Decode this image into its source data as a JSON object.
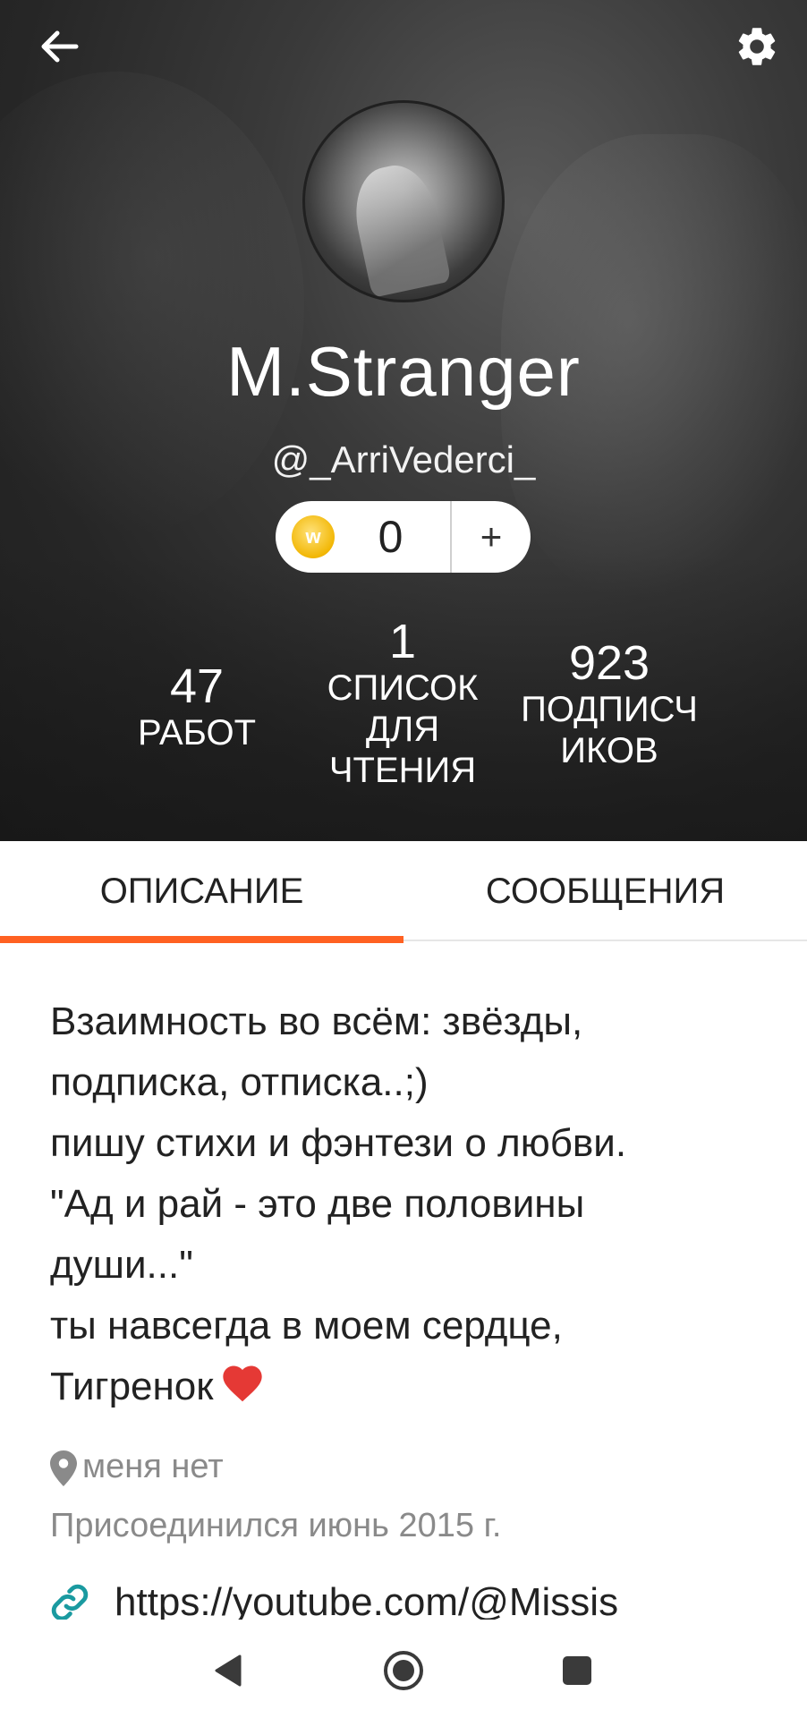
{
  "profile": {
    "display_name": "M.Stranger",
    "username": "@_ArriVederci_",
    "coins": {
      "value": "0",
      "plus_label": "+",
      "coin_symbol": "w"
    },
    "stats": {
      "works": {
        "value": "47",
        "label": "РАБОТ"
      },
      "reading_lists": {
        "value": "1",
        "label": "СПИСОК ДЛЯ ЧТЕНИЯ"
      },
      "followers": {
        "value": "923",
        "label": "ПОДПИСЧ ИКОВ"
      }
    }
  },
  "tabs": [
    {
      "label": "ОПИСАНИЕ",
      "active": true
    },
    {
      "label": "СООБЩЕНИЯ",
      "active": false
    }
  ],
  "about": {
    "bio": "Взаимность во всём: звёзды,\nподписка, отписка..;)\nпишу стихи и фэнтези о любви.\n\"Ад и рай - это две половины\nдуши...\"\nты навсегда в моем сердце,\nТигренок",
    "bio_emoji": "heart-emoji",
    "location": "меня нет",
    "joined": "Присоединился июнь 2015 г.",
    "link": "https://youtube.com/@Missis"
  },
  "icons": {
    "back": "arrow-left-icon",
    "settings": "gear-icon",
    "location": "location-pin-icon",
    "link": "link-icon"
  },
  "colors": {
    "accent": "#ff6122",
    "header_bg": "#2a2a2a",
    "link_icon": "#1a9aa0",
    "muted_text": "#8a8a8a",
    "coin": "#f2b705"
  }
}
